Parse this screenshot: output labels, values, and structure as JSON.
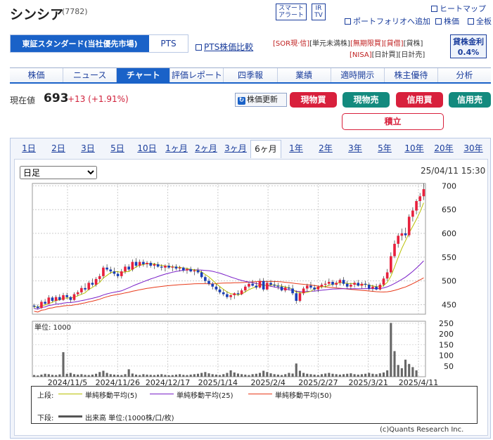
{
  "header": {
    "title": "シンシア",
    "code": "(7782)",
    "smart_alert": [
      "スマート",
      "アラート"
    ],
    "ir_tv": [
      "IR",
      "TV"
    ],
    "links": {
      "heatmap": "ヒートマップ",
      "portfolio": "ポートフォリオへ追加",
      "stock_price": "株価",
      "all_board": "全板"
    }
  },
  "market": {
    "selected": "東証スタンダード(当社優先市場)",
    "pts": "PTS",
    "pts_compare": "PTS株価比較"
  },
  "tags": {
    "row1": [
      "[SOR",
      "現",
      "信",
      "]",
      "[単元未満株]",
      "[無期限",
      "買",
      "]",
      "[",
      "貸借",
      "]",
      "[",
      "貸株",
      "]"
    ],
    "sor": "[SOR現·信]",
    "tangen": "[単元未満株]",
    "mukigen": "[無期限買]",
    "taishaku": "[貸借]",
    "kashikabu": "[貸株]",
    "nisa": "[NISA]",
    "nichi_kabu": "[日計買]",
    "nichi_uri": "[日計売]"
  },
  "fee": {
    "label": "貸株金利",
    "value": "0.4%"
  },
  "nav": [
    "株価",
    "ニュース",
    "チャート",
    "評価レポート",
    "四季報",
    "業績",
    "適時開示",
    "株主優待",
    "分析"
  ],
  "nav_active": 2,
  "quote": {
    "label": "現在値",
    "price": "693",
    "change": "+13 (+1.91%)",
    "refresh": "株価更新"
  },
  "trade": {
    "buy_spot": "現物買",
    "sell_spot": "現物売",
    "buy_margin": "信用買",
    "sell_margin": "信用売",
    "tsumitate": "積立"
  },
  "periods": [
    "1日",
    "2日",
    "3日",
    "5日",
    "10日",
    "1ヶ月",
    "2ヶ月",
    "3ヶ月",
    "6ヶ月",
    "1年",
    "2年",
    "3年",
    "5年",
    "10年",
    "20年",
    "30年"
  ],
  "period_active": 8,
  "chart_select": {
    "value": "日足"
  },
  "datetime": "25/04/11 15:30",
  "volume_unit": "単位: 1000",
  "legend": {
    "upper": "上段:",
    "ma5": "単純移動平均(5)",
    "ma25": "単純移動平均(25)",
    "ma50": "単純移動平均(50)",
    "lower": "下段:",
    "volume": "出来高 単位:(1000株/口/枚)"
  },
  "copyright": "(c)Quants Research Inc.",
  "colors": {
    "up": "#e8203c",
    "down": "#1a3fb8",
    "ma5": "#b8c000",
    "ma25": "#7a20c8",
    "ma50": "#e83a1a",
    "accent": "#1a62c8"
  },
  "chart_data": {
    "type": "candlestick",
    "price_ylim": [
      430,
      705
    ],
    "price_ticks": [
      450,
      500,
      550,
      600,
      650,
      700
    ],
    "volume_ylim": [
      0,
      260
    ],
    "volume_ticks": [
      50,
      100,
      150,
      200,
      250
    ],
    "x_labels": [
      "2024/11/5",
      "2024/11/26",
      "2024/12/17",
      "2025/1/14",
      "2025/2/4",
      "2025/2/27",
      "2025/3/21",
      "2025/4/11"
    ],
    "ohlc": [
      [
        448,
        452,
        442,
        446
      ],
      [
        446,
        450,
        440,
        443
      ],
      [
        443,
        460,
        441,
        456
      ],
      [
        456,
        462,
        450,
        452
      ],
      [
        452,
        470,
        450,
        465
      ],
      [
        465,
        468,
        455,
        458
      ],
      [
        458,
        470,
        452,
        466
      ],
      [
        466,
        472,
        458,
        460
      ],
      [
        460,
        475,
        458,
        470
      ],
      [
        470,
        475,
        462,
        466
      ],
      [
        466,
        468,
        455,
        460
      ],
      [
        460,
        476,
        458,
        472
      ],
      [
        472,
        480,
        468,
        476
      ],
      [
        476,
        490,
        472,
        485
      ],
      [
        485,
        495,
        478,
        482
      ],
      [
        482,
        500,
        480,
        496
      ],
      [
        496,
        505,
        488,
        492
      ],
      [
        492,
        508,
        488,
        504
      ],
      [
        504,
        515,
        498,
        510
      ],
      [
        510,
        532,
        505,
        528
      ],
      [
        528,
        535,
        520,
        524
      ],
      [
        524,
        530,
        515,
        520
      ],
      [
        520,
        528,
        510,
        515
      ],
      [
        515,
        520,
        505,
        510
      ],
      [
        510,
        525,
        505,
        520
      ],
      [
        520,
        535,
        515,
        530
      ],
      [
        530,
        535,
        520,
        524
      ],
      [
        524,
        545,
        520,
        540
      ],
      [
        540,
        548,
        528,
        532
      ],
      [
        532,
        545,
        528,
        540
      ],
      [
        540,
        545,
        530,
        535
      ],
      [
        535,
        542,
        528,
        538
      ],
      [
        538,
        542,
        528,
        532
      ],
      [
        532,
        538,
        525,
        535
      ],
      [
        535,
        540,
        528,
        530
      ],
      [
        530,
        535,
        522,
        528
      ],
      [
        528,
        535,
        520,
        532
      ],
      [
        532,
        538,
        525,
        528
      ],
      [
        528,
        534,
        520,
        530
      ],
      [
        530,
        535,
        522,
        526
      ],
      [
        526,
        532,
        520,
        528
      ],
      [
        528,
        530,
        518,
        522
      ],
      [
        522,
        528,
        515,
        525
      ],
      [
        525,
        530,
        518,
        520
      ],
      [
        520,
        525,
        512,
        522
      ],
      [
        522,
        528,
        515,
        518
      ],
      [
        518,
        522,
        505,
        508
      ],
      [
        508,
        512,
        495,
        500
      ],
      [
        500,
        505,
        490,
        494
      ],
      [
        494,
        498,
        482,
        488
      ],
      [
        488,
        494,
        478,
        482
      ],
      [
        482,
        488,
        472,
        476
      ],
      [
        476,
        482,
        468,
        472
      ],
      [
        472,
        478,
        462,
        466
      ],
      [
        466,
        472,
        460,
        470
      ],
      [
        470,
        476,
        462,
        474
      ],
      [
        474,
        480,
        468,
        472
      ],
      [
        472,
        484,
        470,
        480
      ],
      [
        480,
        492,
        476,
        488
      ],
      [
        488,
        498,
        484,
        494
      ],
      [
        494,
        502,
        488,
        490
      ],
      [
        490,
        498,
        482,
        486
      ],
      [
        486,
        505,
        484,
        500
      ],
      [
        500,
        506,
        478,
        482
      ],
      [
        482,
        500,
        480,
        496
      ],
      [
        496,
        502,
        488,
        492
      ],
      [
        492,
        500,
        486,
        490
      ],
      [
        490,
        496,
        482,
        488
      ],
      [
        488,
        494,
        478,
        480
      ],
      [
        480,
        490,
        476,
        486
      ],
      [
        486,
        492,
        480,
        484
      ],
      [
        484,
        492,
        470,
        474
      ],
      [
        474,
        480,
        452,
        458
      ],
      [
        458,
        478,
        455,
        474
      ],
      [
        474,
        488,
        470,
        484
      ],
      [
        484,
        494,
        478,
        490
      ],
      [
        490,
        498,
        482,
        486
      ],
      [
        486,
        492,
        478,
        482
      ],
      [
        482,
        490,
        476,
        488
      ],
      [
        488,
        496,
        484,
        492
      ],
      [
        492,
        500,
        486,
        494
      ],
      [
        494,
        505,
        490,
        498
      ],
      [
        498,
        502,
        488,
        492
      ],
      [
        492,
        500,
        486,
        496
      ],
      [
        496,
        505,
        490,
        502
      ],
      [
        502,
        508,
        490,
        494
      ],
      [
        494,
        500,
        484,
        488
      ],
      [
        488,
        496,
        482,
        492
      ],
      [
        492,
        500,
        486,
        496
      ],
      [
        496,
        502,
        488,
        490
      ],
      [
        490,
        498,
        484,
        494
      ],
      [
        494,
        500,
        486,
        492
      ],
      [
        492,
        496,
        480,
        484
      ],
      [
        484,
        492,
        478,
        488
      ],
      [
        488,
        494,
        480,
        482
      ],
      [
        482,
        496,
        480,
        492
      ],
      [
        492,
        510,
        488,
        505
      ],
      [
        505,
        525,
        500,
        518
      ],
      [
        518,
        560,
        515,
        552
      ],
      [
        552,
        585,
        548,
        578
      ],
      [
        578,
        600,
        570,
        595
      ],
      [
        595,
        610,
        585,
        600
      ],
      [
        600,
        612,
        590,
        596
      ],
      [
        596,
        640,
        592,
        635
      ],
      [
        635,
        655,
        625,
        648
      ],
      [
        648,
        672,
        640,
        668
      ],
      [
        668,
        685,
        655,
        678
      ],
      [
        678,
        705,
        670,
        693
      ]
    ],
    "volume": [
      8,
      6,
      10,
      14,
      12,
      9,
      8,
      11,
      115,
      14,
      18,
      12,
      10,
      12,
      9,
      8,
      10,
      14,
      22,
      28,
      18,
      12,
      10,
      9,
      8,
      12,
      35,
      15,
      10,
      8,
      12,
      10,
      9,
      8,
      10,
      12,
      9,
      7,
      8,
      10,
      12,
      9,
      8,
      10,
      12,
      14,
      18,
      22,
      16,
      12,
      10,
      8,
      12,
      18,
      30,
      20,
      15,
      12,
      10,
      8,
      12,
      14,
      18,
      28,
      22,
      16,
      12,
      10,
      8,
      12,
      18,
      15,
      62,
      28,
      18,
      14,
      12,
      10,
      8,
      12,
      15,
      18,
      14,
      12,
      10,
      12,
      14,
      16,
      12,
      10,
      12,
      14,
      18,
      14,
      12,
      16,
      20,
      30,
      252,
      120,
      55,
      40,
      80,
      60,
      45,
      30
    ]
  }
}
